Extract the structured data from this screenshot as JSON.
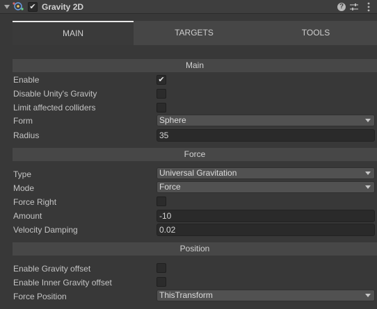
{
  "header": {
    "title": "Gravity 2D",
    "enabled_mark": "✔",
    "icons": [
      "gravity-component-icon",
      "help-icon",
      "preset-icon",
      "more-menu-icon"
    ]
  },
  "tabs": [
    {
      "label": "MAIN",
      "active": true
    },
    {
      "label": "TARGETS",
      "active": false
    },
    {
      "label": "TOOLS",
      "active": false
    }
  ],
  "sections": {
    "main": "Main",
    "force": "Force",
    "position": "Position"
  },
  "main": {
    "enable_label": "Enable",
    "enable_checked": true,
    "enable_mark": "✔",
    "disable_gravity_label": "Disable Unity's Gravity",
    "limit_colliders_label": "Limit affected colliders",
    "form_label": "Form",
    "form_value": "Sphere",
    "radius_label": "Radius",
    "radius_value": "35"
  },
  "force": {
    "type_label": "Type",
    "type_value": "Universal Gravitation",
    "mode_label": "Mode",
    "mode_value": "Force",
    "force_right_label": "Force Right",
    "amount_label": "Amount",
    "amount_value": "-10",
    "damping_label": "Velocity Damping",
    "damping_value": "0.02"
  },
  "position": {
    "gravity_offset_label": "Enable Gravity offset",
    "inner_offset_label": "Enable Inner Gravity offset",
    "force_position_label": "Force Position",
    "force_position_value": "ThisTransform"
  },
  "colors": {
    "background": "#383838",
    "section_header": "#474747",
    "tab_bar": "#464646",
    "field": "#2a2a2a",
    "dropdown": "#515151",
    "text": "#c8c8c8"
  }
}
